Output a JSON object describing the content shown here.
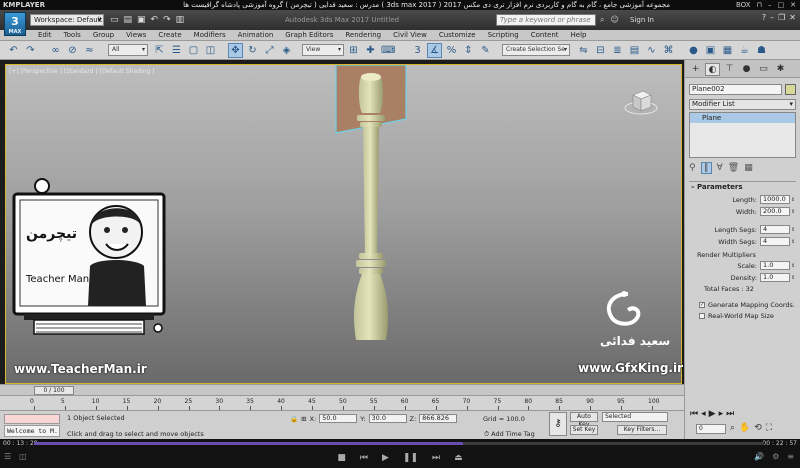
{
  "kmplayer": {
    "logo": "KMPLAYER",
    "title": "مجموعه آموزشی جامع ، گام به گام و کاربردی نرم افزار تری دی مکس 2017 ( 3ds max 2017 )   مدرس : سعید فدایی ( تیچرمن ) گروه آموزشی پادشاه گرافیست ها",
    "box_label": "BOX",
    "time_elapsed": "00 : 13 : 28",
    "time_total": "00 : 22 : 57",
    "progress_fraction": 0.587
  },
  "max": {
    "logo_label": "3",
    "logo_sub": "MAX",
    "workspace": "Workspace: Default",
    "app_title": "Autodesk 3ds Max 2017     Untitled",
    "search_placeholder": "Type a keyword or phrase",
    "sign_in": "Sign In"
  },
  "menu": [
    "Edit",
    "Tools",
    "Group",
    "Views",
    "Create",
    "Modifiers",
    "Animation",
    "Graph Editors",
    "Rendering",
    "Civil View",
    "Customize",
    "Scripting",
    "Content",
    "Help"
  ],
  "toolbar": {
    "filter": "All",
    "ref_coord": "View",
    "selection_set": "Create Selection Se"
  },
  "viewport": {
    "label": "[+] [Perspective ] [Standard ] [Default Shading ]"
  },
  "watermarks": {
    "teacherman_url": "www.TeacherMan.ir",
    "teacherman_name": "Teacher Man",
    "teacherman_fa": "تیچرمن",
    "gfx_url": "www.GfxKing.ir",
    "gfx_name": "سعید فدائی"
  },
  "command_panel": {
    "object_name": "Plane002",
    "modifier_list": "Modifier List",
    "stack_item": "Plane",
    "rollout_title": "Parameters",
    "length_label": "Length:",
    "length": "1000.0",
    "width_label": "Width:",
    "width": "200.0",
    "length_segs_label": "Length Segs:",
    "length_segs": "4",
    "width_segs_label": "Width Segs:",
    "width_segs": "4",
    "render_mult_label": "Render Multipliers",
    "scale_label": "Scale:",
    "scale": "1.0",
    "density_label": "Density:",
    "density": "1.0",
    "total_faces": "Total Faces : 32",
    "gen_mapping": "Generate Mapping Coords.",
    "real_world": "Real-World Map Size"
  },
  "timeline": {
    "slider": "0 / 100",
    "ticks": [
      "0",
      "5",
      "10",
      "15",
      "20",
      "25",
      "30",
      "35",
      "40",
      "45",
      "50",
      "55",
      "60",
      "65",
      "70",
      "75",
      "80",
      "85",
      "90",
      "95",
      "100"
    ]
  },
  "status": {
    "maxscript": "Welcome to M.",
    "selection": "1 Object Selected",
    "prompt": "Click and drag to select and move objects",
    "x_label": "X:",
    "x": "50.0",
    "y_label": "Y:",
    "y": "30.0",
    "z_label": "Z:",
    "z": "866.826",
    "grid": "Grid = 100.0",
    "add_time_tag": "Add Time Tag",
    "auto_key": "Auto Key",
    "set_key": "Set Key",
    "selected": "Selected",
    "key_filters": "Key Filters...",
    "frame": "0"
  }
}
